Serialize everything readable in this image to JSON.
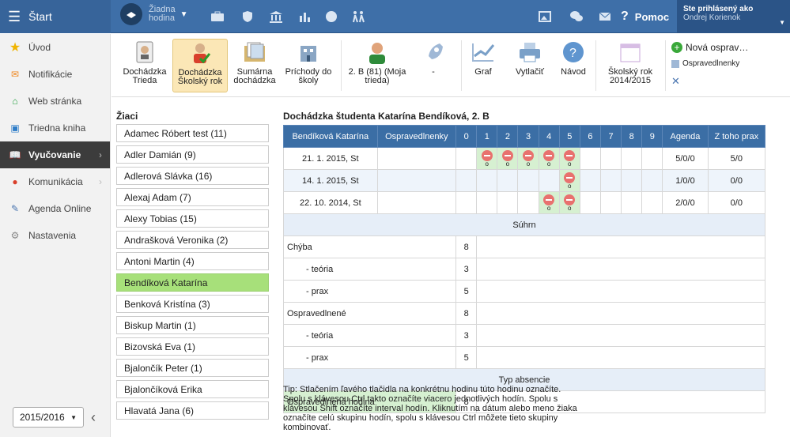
{
  "topbar": {
    "brand": "Štart",
    "hour_line1": "Žiadna",
    "hour_line2": "hodina",
    "help": "Pomoc",
    "user_label": "Ste prihlásený ako",
    "user_name": "Ondrej Korienok"
  },
  "sidebar": {
    "items": [
      {
        "label": "Úvod",
        "icon": "star-icon"
      },
      {
        "label": "Notifikácie",
        "icon": "mail-icon"
      },
      {
        "label": "Web stránka",
        "icon": "home-icon"
      },
      {
        "label": "Triedna kniha",
        "icon": "book-icon"
      },
      {
        "label": "Vyučovanie",
        "icon": "open-book-icon",
        "active": true
      },
      {
        "label": "Komunikácia",
        "icon": "chat-icon"
      },
      {
        "label": "Agenda Online",
        "icon": "pencil-icon"
      },
      {
        "label": "Nastavenia",
        "icon": "gear-icon"
      }
    ],
    "year": "2015/2016"
  },
  "toolbar": {
    "dochadzka_trieda_1": "Dochádzka",
    "dochadzka_trieda_2": "Trieda",
    "dochadzka_rok_1": "Dochádzka",
    "dochadzka_rok_2": "Školský rok",
    "sumarna_1": "Sumárna",
    "sumarna_2": "dochádzka",
    "prichody_1": "Príchody do",
    "prichody_2": "školy",
    "class_1": "2. B (81) (Moja",
    "class_2": "trieda)",
    "dash": "-",
    "graf": "Graf",
    "vytlacit": "Vytlačiť",
    "navod": "Návod",
    "skrok_1": "Školský rok",
    "skrok_2": "2014/2015",
    "nova": "Nová osprav…",
    "osprav": "Ospravedlnenky"
  },
  "students": {
    "header": "Žiaci",
    "list": [
      "Adamec Róbert test (11)",
      "Adler Damián (9)",
      "Adlerová Slávka (16)",
      "Alexaj Adam (7)",
      "Alexy Tobias (15)",
      "Andrašková Veronika (2)",
      "Antoni Martin (4)",
      "Bendíková Katarína",
      "Benková Kristína (3)",
      "Biskup Martin (1)",
      "Bizovská Eva (1)",
      "Bjalončík Peter (1)",
      "Bjalončíková Erika",
      "Hlavatá Jana (6)"
    ]
  },
  "main": {
    "title": "Dochádzka študenta Katarína Bendíková, 2. B",
    "headers": [
      "Bendíková Katarína",
      "Ospravedlnenky",
      "0",
      "1",
      "2",
      "3",
      "4",
      "5",
      "6",
      "7",
      "8",
      "9",
      "Agenda",
      "Z toho prax"
    ],
    "rows": [
      {
        "date": "21. 1. 2015, St",
        "agenda": "5/0/0",
        "prax": "5/0",
        "marks": [
          1,
          2,
          3,
          4,
          5
        ]
      },
      {
        "date": "14. 1. 2015, St",
        "agenda": "1/0/0",
        "prax": "0/0",
        "marks": [
          5
        ]
      },
      {
        "date": "22. 10. 2014, St",
        "agenda": "2/0/0",
        "prax": "0/0",
        "marks": [
          4,
          5
        ]
      }
    ],
    "mark_letter": "o",
    "summary_header": "Súhrn",
    "summary": [
      {
        "label": "Chýba",
        "value": "8"
      },
      {
        "label": "- teória",
        "value": "3"
      },
      {
        "label": "- prax",
        "value": "5"
      },
      {
        "label": "Ospravedlnené",
        "value": "8"
      },
      {
        "label": "- teória",
        "value": "3"
      },
      {
        "label": "- prax",
        "value": "5"
      }
    ],
    "type_header": "Typ absencie",
    "type_row": {
      "label": "Ospravedlnená hodina",
      "value": "8"
    }
  },
  "tip": "Tip: Stlačením ľavého tlačidla na konkrétnu hodinu túto hodinu označíte. Spolu s klávesou Ctrl takto označíte viacero jednotlivých hodín. Spolu s klávesou Shift označíte interval hodín. Kliknutím na dátum alebo meno žiaka označíte celú skupinu hodín, spolu s klávesou Ctrl môžete tieto skupiny kombinovať."
}
